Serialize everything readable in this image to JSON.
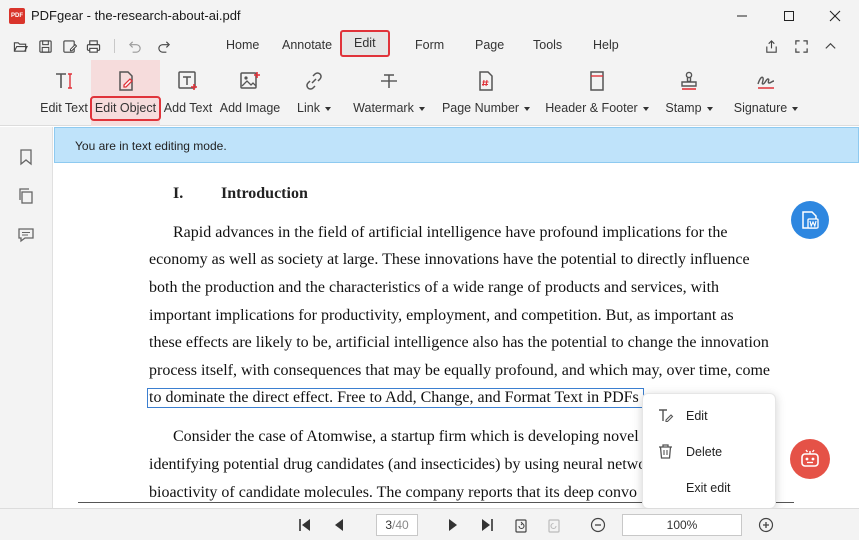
{
  "window": {
    "title": "PDFgear - the-research-about-ai.pdf",
    "logo_text": "PDF"
  },
  "menu": {
    "tabs": [
      "Home",
      "Annotate",
      "Edit",
      "Form",
      "Page",
      "Tools",
      "Help"
    ],
    "active": "Edit"
  },
  "toolbar": {
    "tools": [
      {
        "label": "Edit Text",
        "icon": "text-cursor-icon"
      },
      {
        "label": "Edit Object",
        "icon": "edit-object-icon",
        "selected": true
      },
      {
        "label": "Add Text",
        "icon": "add-text-icon"
      },
      {
        "label": "Add Image",
        "icon": "add-image-icon"
      },
      {
        "label": "Link",
        "icon": "link-icon",
        "dropdown": true
      },
      {
        "label": "Watermark",
        "icon": "watermark-icon",
        "dropdown": true
      },
      {
        "label": "Page Number",
        "icon": "page-number-icon",
        "dropdown": true
      },
      {
        "label": "Header & Footer",
        "icon": "header-footer-icon",
        "dropdown": true
      },
      {
        "label": "Stamp",
        "icon": "stamp-icon",
        "dropdown": true
      },
      {
        "label": "Signature",
        "icon": "signature-icon",
        "dropdown": true
      }
    ]
  },
  "banner": {
    "text": "You are in text editing mode."
  },
  "document": {
    "heading_number": "I.",
    "heading_title": "Introduction",
    "lines": [
      "Rapid advances in the field of artificial intelligence have profound implications for the",
      "economy as well as society at large.  These innovations have the potential to directly influence",
      "both the production and the characteristics of a wide range of products and services, with",
      "important implications for productivity, employment, and competition.  But, as important as",
      "these effects are likely to be, artificial intelligence also has the potential to change the innovation",
      "process itself, with consequences that may be equally profound, and which may, over time, come",
      "to dominate the direct effect. Free to Add, Change, and Format Text in PDFs",
      "Consider the case of Atomwise, a startup firm which is developing novel",
      "identifying potential drug candidates (and insecticides) by using neural netwo",
      "bioactivity of candidate molecules.  The company reports that its deep convo"
    ]
  },
  "context_menu": {
    "items": [
      {
        "label": "Edit",
        "icon": "edit-text-icon"
      },
      {
        "label": "Delete",
        "icon": "trash-icon"
      },
      {
        "label": "Exit edit",
        "icon": ""
      }
    ]
  },
  "bottombar": {
    "current_page": "3",
    "total_pages": "/40",
    "zoom": "100%"
  },
  "colors": {
    "accent_red": "#e0333a",
    "banner_blue": "#bfe3fa",
    "fab_blue": "#2e87e0",
    "fab_red": "#e55247"
  }
}
